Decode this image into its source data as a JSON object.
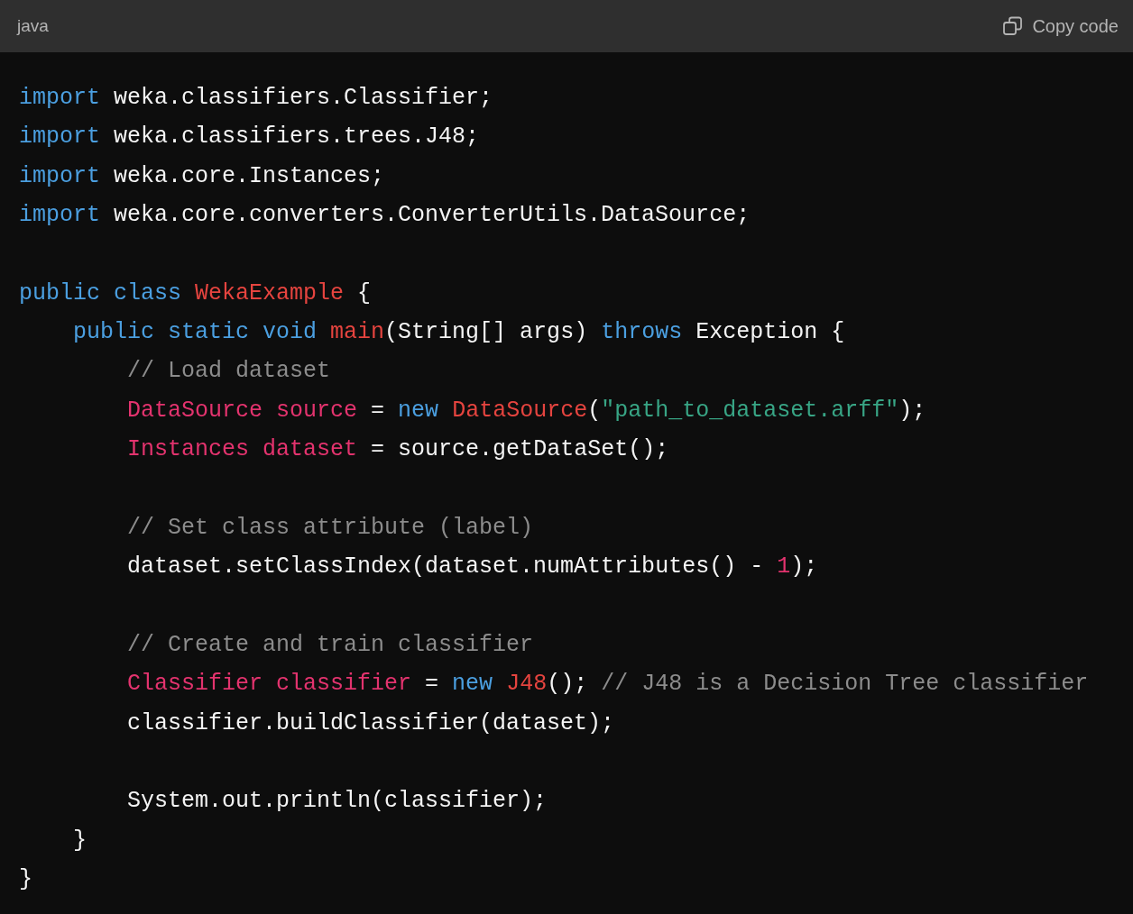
{
  "header": {
    "language": "java",
    "copy_label": "Copy code"
  },
  "lines": [
    {
      "kind": "code",
      "tokens": [
        {
          "text": "import",
          "kind": "keyword"
        },
        {
          "text": " weka.classifiers.Classifier;",
          "kind": "plain"
        }
      ]
    },
    {
      "kind": "code",
      "tokens": [
        {
          "text": "import",
          "kind": "keyword"
        },
        {
          "text": " weka.classifiers.trees.J48;",
          "kind": "plain"
        }
      ]
    },
    {
      "kind": "code",
      "tokens": [
        {
          "text": "import",
          "kind": "keyword"
        },
        {
          "text": " weka.core.Instances;",
          "kind": "plain"
        }
      ]
    },
    {
      "kind": "code",
      "tokens": [
        {
          "text": "import",
          "kind": "keyword"
        },
        {
          "text": " weka.core.converters.ConverterUtils.DataSource;",
          "kind": "plain"
        }
      ]
    },
    {
      "kind": "blank"
    },
    {
      "kind": "code",
      "tokens": [
        {
          "text": "public",
          "kind": "keyword"
        },
        {
          "text": " class",
          "kind": "keyword"
        },
        {
          "text": " WekaExample",
          "kind": "title"
        },
        {
          "text": " {",
          "kind": "plain"
        }
      ]
    },
    {
      "kind": "code",
      "tokens": [
        {
          "text": "    public",
          "kind": "keyword"
        },
        {
          "text": " static",
          "kind": "keyword"
        },
        {
          "text": " void",
          "kind": "keyword"
        },
        {
          "text": " main",
          "kind": "title"
        },
        {
          "text": "(String[] args) ",
          "kind": "plain"
        },
        {
          "text": "throws",
          "kind": "keyword"
        },
        {
          "text": " Exception {",
          "kind": "plain"
        }
      ]
    },
    {
      "kind": "code",
      "tokens": [
        {
          "text": "        // Load dataset",
          "kind": "comment"
        }
      ]
    },
    {
      "kind": "code",
      "tokens": [
        {
          "text": "        DataSource",
          "kind": "variable"
        },
        {
          "text": " source",
          "kind": "variable"
        },
        {
          "text": " = ",
          "kind": "plain"
        },
        {
          "text": "new",
          "kind": "keyword"
        },
        {
          "text": " DataSource",
          "kind": "title"
        },
        {
          "text": "(",
          "kind": "plain"
        },
        {
          "text": "\"path_to_dataset.arff\"",
          "kind": "string"
        },
        {
          "text": ");",
          "kind": "plain"
        }
      ]
    },
    {
      "kind": "code",
      "tokens": [
        {
          "text": "        Instances",
          "kind": "variable"
        },
        {
          "text": " dataset",
          "kind": "variable"
        },
        {
          "text": " = source.getDataSet();",
          "kind": "plain"
        }
      ]
    },
    {
      "kind": "blank"
    },
    {
      "kind": "code",
      "tokens": [
        {
          "text": "        // Set class attribute (label)",
          "kind": "comment"
        }
      ]
    },
    {
      "kind": "code",
      "tokens": [
        {
          "text": "        dataset.setClassIndex(dataset.numAttributes() - ",
          "kind": "plain"
        },
        {
          "text": "1",
          "kind": "number"
        },
        {
          "text": ");",
          "kind": "plain"
        }
      ]
    },
    {
      "kind": "blank"
    },
    {
      "kind": "code",
      "tokens": [
        {
          "text": "        // Create and train classifier",
          "kind": "comment"
        }
      ]
    },
    {
      "kind": "code",
      "tokens": [
        {
          "text": "        Classifier",
          "kind": "variable"
        },
        {
          "text": " classifier",
          "kind": "variable"
        },
        {
          "text": " = ",
          "kind": "plain"
        },
        {
          "text": "new",
          "kind": "keyword"
        },
        {
          "text": " J48",
          "kind": "title"
        },
        {
          "text": "(); ",
          "kind": "plain"
        },
        {
          "text": "// J48 is a Decision Tree classifier",
          "kind": "comment"
        }
      ]
    },
    {
      "kind": "code",
      "tokens": [
        {
          "text": "        classifier.buildClassifier(dataset);",
          "kind": "plain"
        }
      ]
    },
    {
      "kind": "blank"
    },
    {
      "kind": "code",
      "tokens": [
        {
          "text": "        System.out.println(classifier);",
          "kind": "plain"
        }
      ]
    },
    {
      "kind": "code",
      "tokens": [
        {
          "text": "    }",
          "kind": "plain"
        }
      ]
    },
    {
      "kind": "code",
      "tokens": [
        {
          "text": "}",
          "kind": "plain"
        }
      ]
    }
  ]
}
